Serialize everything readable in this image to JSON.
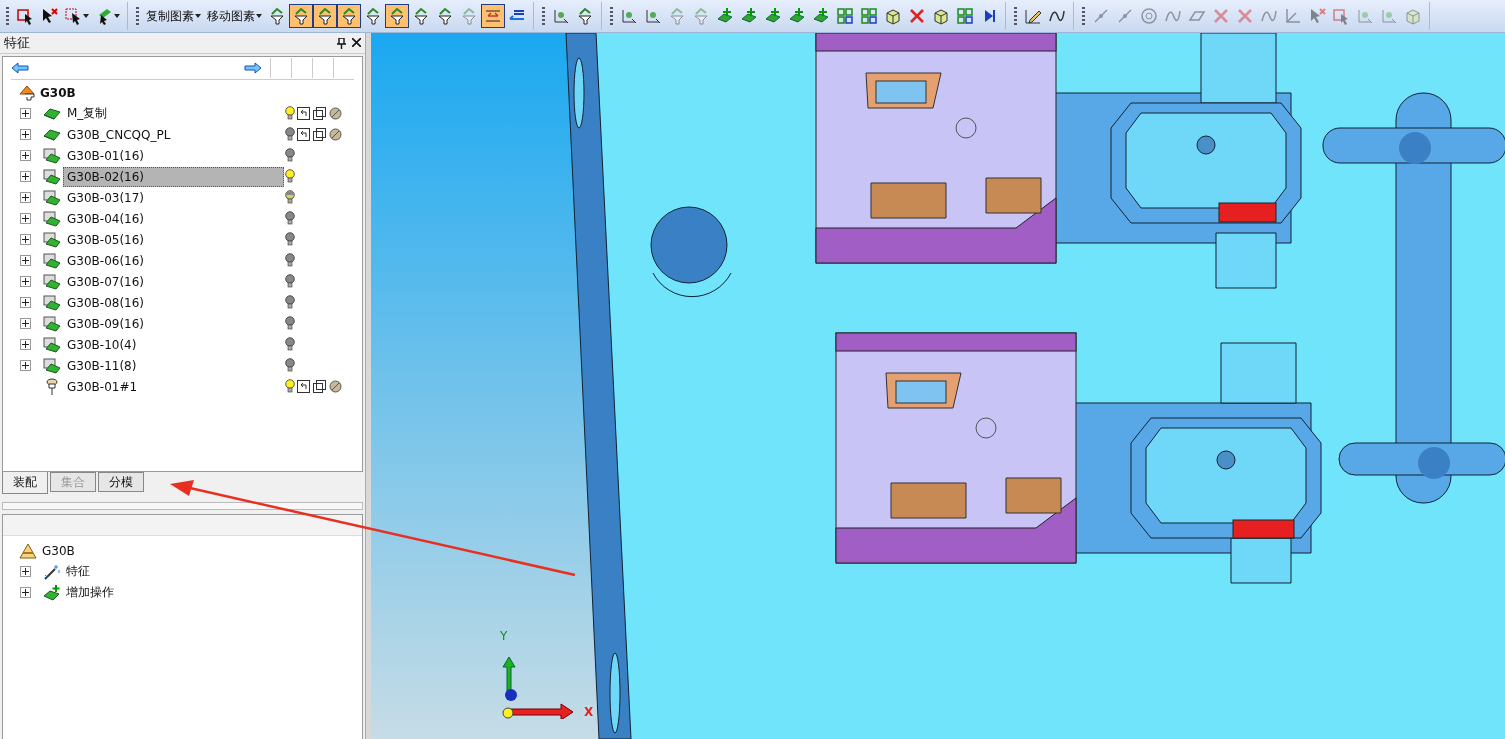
{
  "toolbar": {
    "groups": [
      {
        "items": [
          {
            "kind": "icon",
            "selected": false,
            "disabled": false
          },
          {
            "kind": "icon",
            "selected": false,
            "disabled": false
          },
          {
            "kind": "dropdown",
            "selected": false,
            "disabled": false
          },
          {
            "kind": "dropdown",
            "selected": false,
            "disabled": false
          }
        ]
      },
      {
        "items": [
          {
            "kind": "menu",
            "label": "复制图素"
          },
          {
            "kind": "menu",
            "label": "移动图素"
          },
          {
            "kind": "icon",
            "selected": false,
            "disabled": false
          },
          {
            "kind": "icon",
            "selected": true,
            "disabled": false
          },
          {
            "kind": "icon",
            "selected": true,
            "disabled": false
          },
          {
            "kind": "icon",
            "selected": true,
            "disabled": false
          },
          {
            "kind": "icon",
            "selected": false,
            "disabled": false
          },
          {
            "kind": "icon",
            "selected": true,
            "disabled": false
          },
          {
            "kind": "icon",
            "selected": false,
            "disabled": false
          },
          {
            "kind": "icon",
            "selected": false,
            "disabled": false
          },
          {
            "kind": "icon",
            "selected": false,
            "disabled": true
          },
          {
            "kind": "icon",
            "selected": true,
            "disabled": false
          },
          {
            "kind": "icon",
            "selected": false,
            "disabled": false
          }
        ]
      },
      {
        "items": [
          {
            "kind": "icon",
            "selected": false,
            "disabled": false
          },
          {
            "kind": "icon",
            "selected": false,
            "disabled": false
          }
        ]
      },
      {
        "items": [
          {
            "kind": "icon",
            "selected": false,
            "disabled": false
          },
          {
            "kind": "icon",
            "selected": false,
            "disabled": false
          },
          {
            "kind": "icon",
            "selected": false,
            "disabled": true
          },
          {
            "kind": "icon",
            "selected": false,
            "disabled": true
          },
          {
            "kind": "icon",
            "selected": false,
            "disabled": false
          },
          {
            "kind": "icon",
            "selected": false,
            "disabled": false
          },
          {
            "kind": "icon",
            "selected": false,
            "disabled": false
          },
          {
            "kind": "icon",
            "selected": false,
            "disabled": false
          },
          {
            "kind": "icon",
            "selected": false,
            "disabled": false
          },
          {
            "kind": "icon",
            "selected": false,
            "disabled": false
          },
          {
            "kind": "icon",
            "selected": false,
            "disabled": false
          },
          {
            "kind": "icon",
            "selected": false,
            "disabled": false
          },
          {
            "kind": "icon",
            "selected": false,
            "disabled": false
          },
          {
            "kind": "icon",
            "selected": false,
            "disabled": false
          },
          {
            "kind": "icon",
            "selected": false,
            "disabled": false
          },
          {
            "kind": "icon",
            "selected": false,
            "disabled": false
          }
        ]
      },
      {
        "items": [
          {
            "kind": "icon",
            "selected": false,
            "disabled": false
          },
          {
            "kind": "icon",
            "selected": false,
            "disabled": false
          }
        ]
      },
      {
        "items": [
          {
            "kind": "icon",
            "selected": false,
            "disabled": true
          },
          {
            "kind": "icon",
            "selected": false,
            "disabled": true
          },
          {
            "kind": "icon",
            "selected": false,
            "disabled": true
          },
          {
            "kind": "icon",
            "selected": false,
            "disabled": true
          },
          {
            "kind": "icon",
            "selected": false,
            "disabled": true
          },
          {
            "kind": "icon",
            "selected": false,
            "disabled": true
          },
          {
            "kind": "icon",
            "selected": false,
            "disabled": true
          },
          {
            "kind": "icon",
            "selected": false,
            "disabled": true
          },
          {
            "kind": "icon",
            "selected": false,
            "disabled": true
          },
          {
            "kind": "icon",
            "selected": false,
            "disabled": true
          },
          {
            "kind": "icon",
            "selected": false,
            "disabled": true
          },
          {
            "kind": "icon",
            "selected": false,
            "disabled": true
          },
          {
            "kind": "icon",
            "selected": false,
            "disabled": true
          },
          {
            "kind": "icon",
            "selected": false,
            "disabled": true
          }
        ]
      }
    ]
  },
  "feature_panel": {
    "title": "特征",
    "tree": {
      "root": "G30B",
      "items": [
        {
          "label": "M_复制",
          "kind": "solid",
          "lit": true,
          "dimmed": false,
          "extras": true,
          "selected": false,
          "expandable": true
        },
        {
          "label": "G30B_CNCQQ_PL",
          "kind": "solid",
          "lit": false,
          "dimmed": false,
          "extras": true,
          "selected": false,
          "expandable": true
        },
        {
          "label": "G30B-01(16)",
          "kind": "folder",
          "lit": false,
          "dimmed": false,
          "extras": false,
          "selected": false,
          "expandable": true
        },
        {
          "label": "G30B-02(16)",
          "kind": "folder",
          "lit": true,
          "dimmed": false,
          "extras": false,
          "selected": true,
          "expandable": true
        },
        {
          "label": "G30B-03(17)",
          "kind": "folder",
          "lit": true,
          "dimmed": true,
          "extras": false,
          "selected": false,
          "expandable": true
        },
        {
          "label": "G30B-04(16)",
          "kind": "folder",
          "lit": false,
          "dimmed": false,
          "extras": false,
          "selected": false,
          "expandable": true
        },
        {
          "label": "G30B-05(16)",
          "kind": "folder",
          "lit": false,
          "dimmed": false,
          "extras": false,
          "selected": false,
          "expandable": true
        },
        {
          "label": "G30B-06(16)",
          "kind": "folder",
          "lit": false,
          "dimmed": false,
          "extras": false,
          "selected": false,
          "expandable": true
        },
        {
          "label": "G30B-07(16)",
          "kind": "folder",
          "lit": false,
          "dimmed": false,
          "extras": false,
          "selected": false,
          "expandable": true
        },
        {
          "label": "G30B-08(16)",
          "kind": "folder",
          "lit": false,
          "dimmed": false,
          "extras": false,
          "selected": false,
          "expandable": true
        },
        {
          "label": "G30B-09(16)",
          "kind": "folder",
          "lit": false,
          "dimmed": false,
          "extras": false,
          "selected": false,
          "expandable": true
        },
        {
          "label": "G30B-10(4)",
          "kind": "folder",
          "lit": false,
          "dimmed": false,
          "extras": false,
          "selected": false,
          "expandable": true
        },
        {
          "label": "G30B-11(8)",
          "kind": "folder",
          "lit": false,
          "dimmed": false,
          "extras": false,
          "selected": false,
          "expandable": true
        },
        {
          "label": "G30B-01#1",
          "kind": "pin",
          "lit": true,
          "dimmed": false,
          "extras": true,
          "selected": false,
          "expandable": false
        }
      ]
    }
  },
  "tabs": [
    {
      "label": "装配",
      "selected": true,
      "disabled": false
    },
    {
      "label": "集合",
      "selected": false,
      "disabled": true
    },
    {
      "label": "分模",
      "selected": false,
      "disabled": false
    }
  ],
  "assembly_tree": {
    "root": "G30B",
    "items": [
      {
        "label": "特征",
        "kind": "wand"
      },
      {
        "label": "增加操作",
        "kind": "add"
      }
    ]
  },
  "viewport": {
    "axes": {
      "y": "Y",
      "x": "X"
    }
  }
}
